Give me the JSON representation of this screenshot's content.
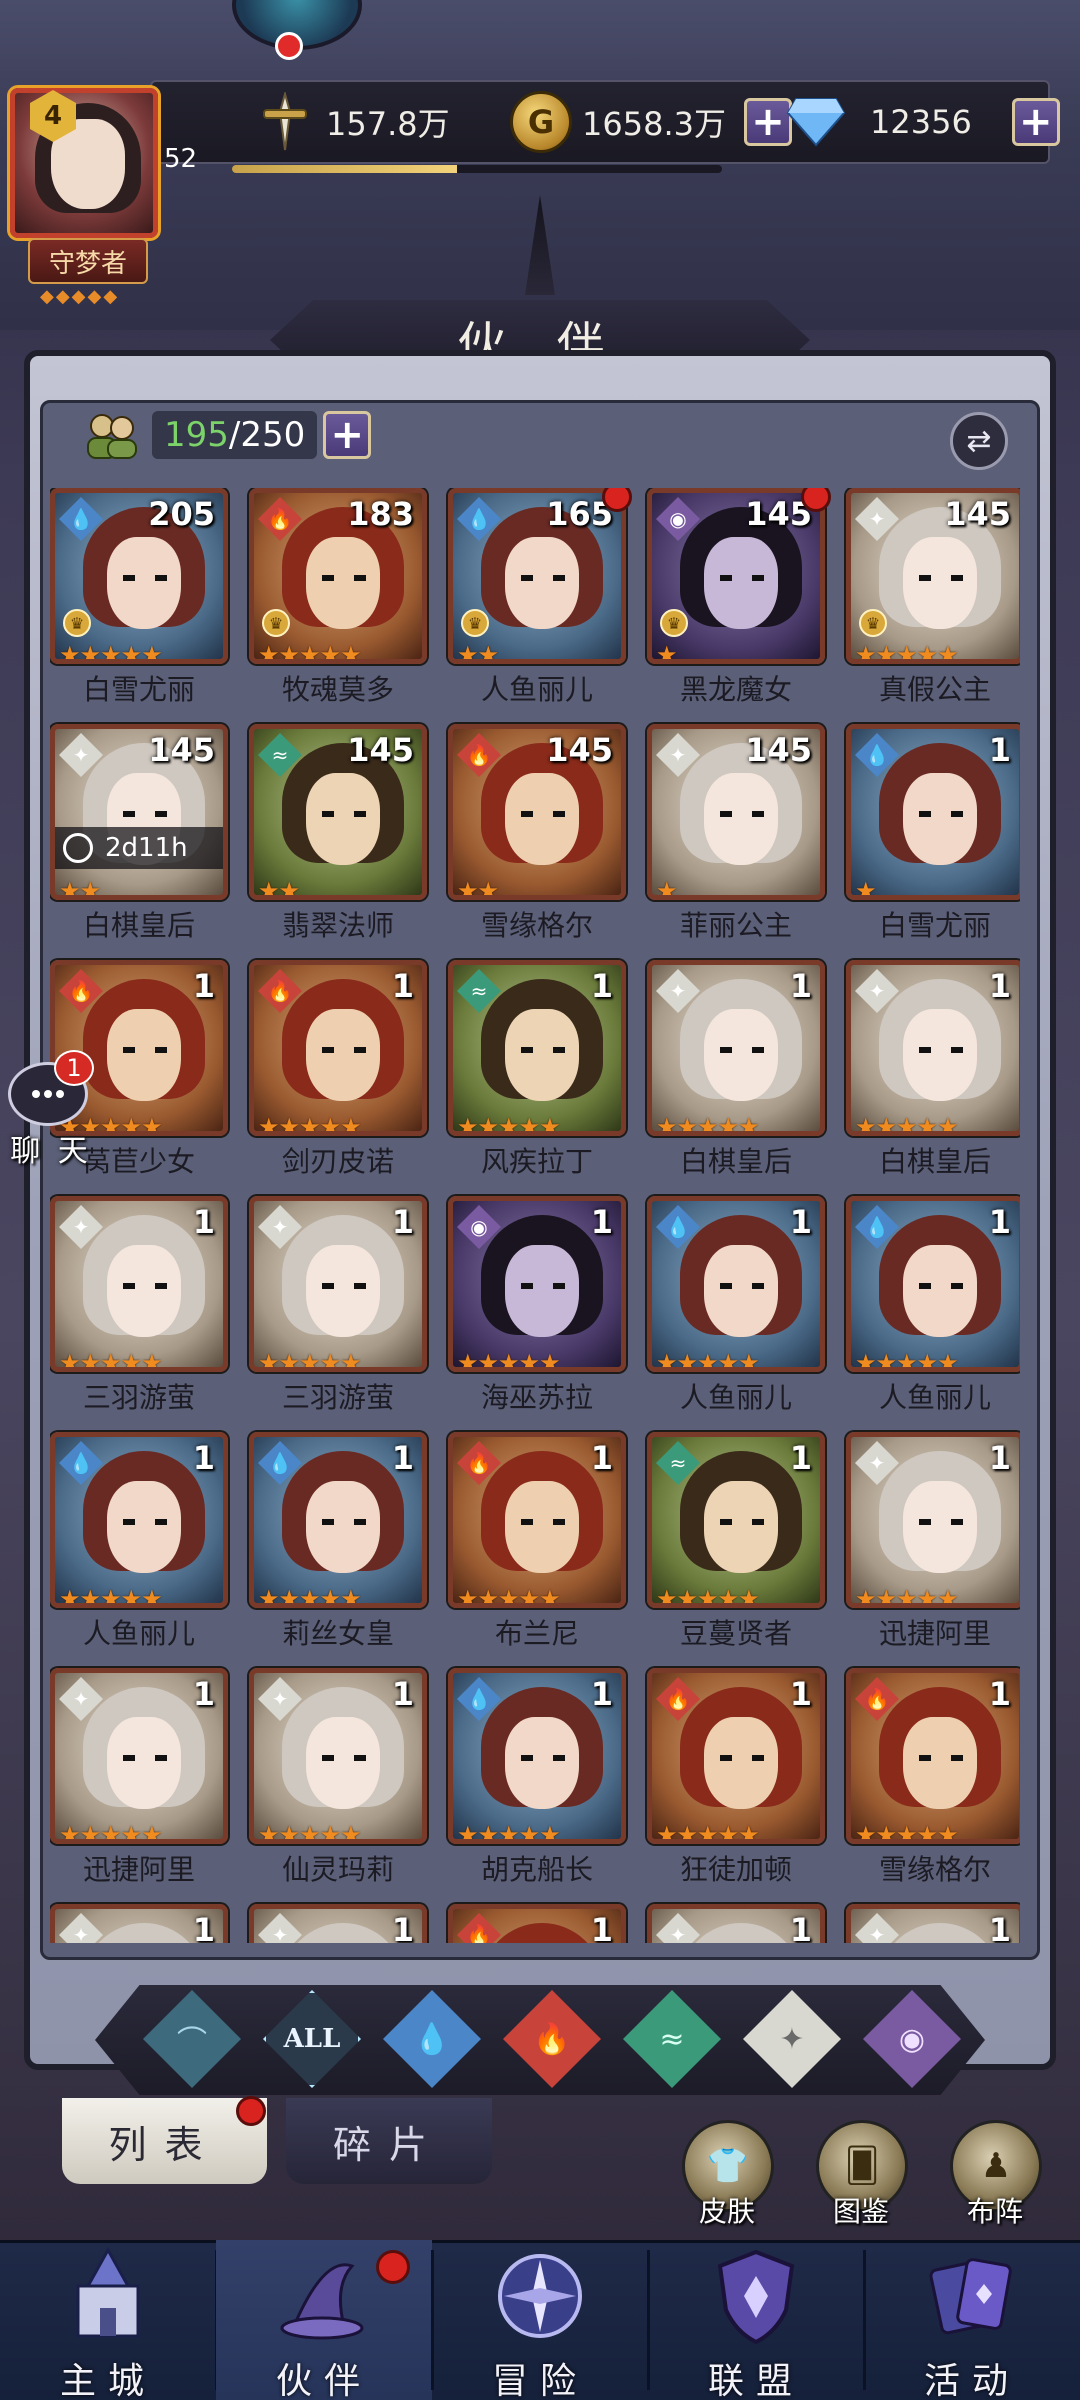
{
  "player": {
    "level_badge": "4",
    "level": "52",
    "title": "守梦者",
    "title_stars": "◆◆◆◆◆",
    "xp_progress": 0.46
  },
  "resources": {
    "power": "157.8万",
    "gold": "1658.3万",
    "gems": "12356"
  },
  "page_title": "伙 伴",
  "roster": {
    "current": "195",
    "separator": "/",
    "max": "250"
  },
  "chat": {
    "label": "聊 天",
    "badge": "1"
  },
  "heroes": [
    {
      "name": "白雪尤丽",
      "level": "205",
      "element": "water",
      "stars": 5,
      "rank": true,
      "dot": false
    },
    {
      "name": "牧魂莫多",
      "level": "183",
      "element": "fire",
      "stars": 5,
      "rank": true,
      "dot": false
    },
    {
      "name": "人鱼丽儿",
      "level": "165",
      "element": "water",
      "stars": 2,
      "rank": true,
      "dot": true
    },
    {
      "name": "黑龙魔女",
      "level": "145",
      "element": "dark",
      "stars": 1,
      "rank": true,
      "dot": true
    },
    {
      "name": "真假公主",
      "level": "145",
      "element": "light",
      "stars": 5,
      "rank": true,
      "dot": false
    },
    {
      "name": "白棋皇后",
      "level": "145",
      "element": "light",
      "stars": 2,
      "timer": "2d11h",
      "dot": false
    },
    {
      "name": "翡翠法师",
      "level": "145",
      "element": "wind",
      "stars": 2,
      "dot": false
    },
    {
      "name": "雪缘格尔",
      "level": "145",
      "element": "fire",
      "stars": 2,
      "dot": false
    },
    {
      "name": "菲丽公主",
      "level": "145",
      "element": "light",
      "stars": 1,
      "dot": false
    },
    {
      "name": "白雪尤丽",
      "level": "1",
      "element": "water",
      "stars": 1,
      "dot": false
    },
    {
      "name": "莴苣少女",
      "level": "1",
      "element": "fire",
      "stars": 5,
      "dot": false
    },
    {
      "name": "剑刃皮诺",
      "level": "1",
      "element": "fire",
      "stars": 5,
      "dot": false
    },
    {
      "name": "风疾拉丁",
      "level": "1",
      "element": "wind",
      "stars": 5,
      "dot": false
    },
    {
      "name": "白棋皇后",
      "level": "1",
      "element": "light",
      "stars": 5,
      "dot": false
    },
    {
      "name": "白棋皇后",
      "level": "1",
      "element": "light",
      "stars": 5,
      "dot": false
    },
    {
      "name": "三羽游萤",
      "level": "1",
      "element": "light",
      "stars": 5,
      "dot": false
    },
    {
      "name": "三羽游萤",
      "level": "1",
      "element": "light",
      "stars": 5,
      "dot": false
    },
    {
      "name": "海巫苏拉",
      "level": "1",
      "element": "dark",
      "stars": 5,
      "dot": false
    },
    {
      "name": "人鱼丽儿",
      "level": "1",
      "element": "water",
      "stars": 5,
      "dot": false
    },
    {
      "name": "人鱼丽儿",
      "level": "1",
      "element": "water",
      "stars": 5,
      "dot": false
    },
    {
      "name": "人鱼丽儿",
      "level": "1",
      "element": "water",
      "stars": 5,
      "dot": false
    },
    {
      "name": "莉丝女皇",
      "level": "1",
      "element": "water",
      "stars": 5,
      "dot": false
    },
    {
      "name": "布兰尼",
      "level": "1",
      "element": "fire",
      "stars": 5,
      "dot": false
    },
    {
      "name": "豆蔓贤者",
      "level": "1",
      "element": "wind",
      "stars": 5,
      "dot": false
    },
    {
      "name": "迅捷阿里",
      "level": "1",
      "element": "light",
      "stars": 5,
      "dot": false
    },
    {
      "name": "迅捷阿里",
      "level": "1",
      "element": "light",
      "stars": 5,
      "dot": false
    },
    {
      "name": "仙灵玛莉",
      "level": "1",
      "element": "light",
      "stars": 5,
      "dot": false
    },
    {
      "name": "胡克船长",
      "level": "1",
      "element": "water",
      "stars": 5,
      "dot": false
    },
    {
      "name": "狂徒加顿",
      "level": "1",
      "element": "fire",
      "stars": 5,
      "dot": false
    },
    {
      "name": "雪缘格尔",
      "level": "1",
      "element": "fire",
      "stars": 5,
      "dot": false
    },
    {
      "name": "",
      "level": "1",
      "element": "light",
      "stars": 0,
      "dot": false
    },
    {
      "name": "",
      "level": "1",
      "element": "light",
      "stars": 0,
      "dot": false
    },
    {
      "name": "",
      "level": "1",
      "element": "fire",
      "stars": 0,
      "dot": false
    },
    {
      "name": "",
      "level": "1",
      "element": "light",
      "stars": 0,
      "dot": false
    },
    {
      "name": "",
      "level": "1",
      "element": "light",
      "stars": 0,
      "dot": false
    }
  ],
  "filters": {
    "all_label": "ALL"
  },
  "tabs": {
    "list": "列表",
    "fragments": "碎片"
  },
  "side_buttons": {
    "skins": "皮肤",
    "codex": "图鉴",
    "formation": "布阵"
  },
  "nav": {
    "main_city": "主城",
    "partners": "伙伴",
    "adventure": "冒险",
    "alliance": "联盟",
    "events": "活动"
  },
  "colors": {
    "water": "#4a86c8",
    "fire": "#c8433a",
    "wind": "#3a9a7a",
    "light": "#d8d8d0",
    "dark": "#7a5aa0",
    "star": "#f08b20"
  }
}
